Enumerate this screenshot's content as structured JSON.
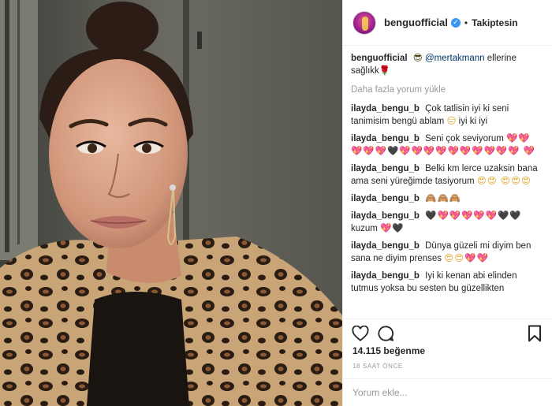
{
  "post": {
    "username": "benguofficial",
    "follow_status": "Takiptesin",
    "caption": {
      "user": "benguofficial",
      "sunglasses_emoji": "😎",
      "mention": "@mertakmann",
      "text": "ellerine sağlıkk",
      "trailing_emoji": "🌹"
    },
    "load_more": "Daha fazla yorum yükle",
    "comments": [
      {
        "user": "ilayda_bengu_b",
        "text": "Çok tatlisin iyi ki seni tanimisim bengü ablam",
        "emoji": "😑",
        "text2": "iyi ki iyi"
      },
      {
        "user": "ilayda_bengu_b",
        "text": "Seni çok seviyorum",
        "emoji": "💖💖 💖💖💖🖤💖💖💖💖💖💖💖💖💖💖 💖"
      },
      {
        "user": "ilayda_bengu_b",
        "text": "Belki km lerce uzaksin bana ama seni yüreğimde tasiyorum",
        "emoji": "😍😍 😍😍😍"
      },
      {
        "user": "ilayda_bengu_b",
        "text": "",
        "emoji": "🙈🙈🙈"
      },
      {
        "user": "ilayda_bengu_b",
        "text": "",
        "emoji": "🖤💖💖💖💖💖🖤🖤",
        "text2": "kuzum",
        "emoji2": "💖🖤"
      },
      {
        "user": "ilayda_bengu_b",
        "text": "Dünya güzeli mi diyim ben sana ne diyim prenses",
        "emoji": "😍😍💖💖"
      },
      {
        "user": "ilayda_bengu_b",
        "text": "Iyi ki kenan abi elinden tutmus yoksa bu sesten bu güzellikten"
      }
    ],
    "likes": "14.115 beğenme",
    "timestamp": "18 SAAT ÖNCE",
    "comment_placeholder": "Yorum ekle..."
  },
  "colors": {
    "verified": "#3897f0",
    "mention": "#003569",
    "muted": "#999999",
    "heart": "#d6245a"
  },
  "icons": {
    "like": "heart-outline-icon",
    "comment": "speech-bubble-icon",
    "save": "bookmark-icon",
    "verified": "verified-badge-icon"
  }
}
